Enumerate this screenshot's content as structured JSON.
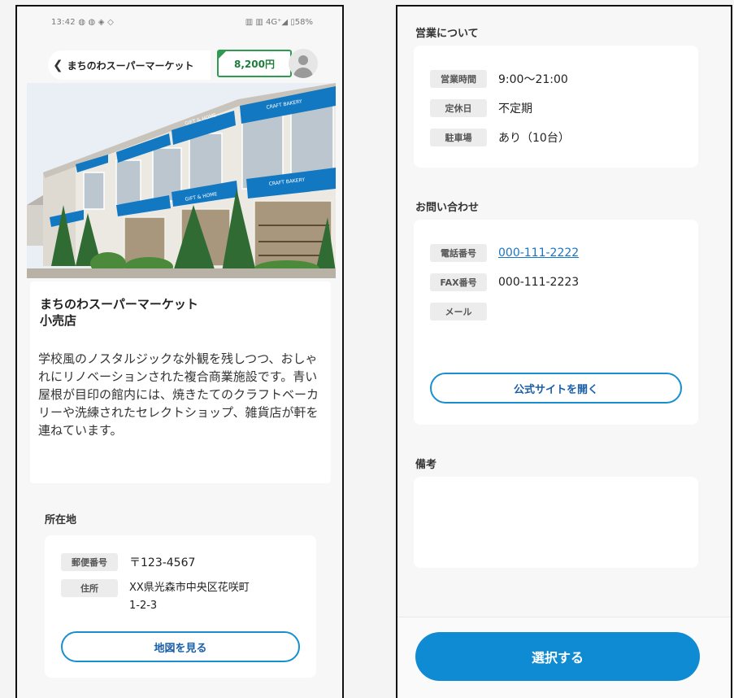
{
  "left": {
    "status": {
      "time": "13:42 ◍ ◍ ◈ ◇",
      "right": "▥ ▥ 4G⁺◢ ▯58%"
    },
    "header": {
      "back_label": "まちのわスーパーマーケット",
      "points": "8,200円"
    },
    "hero": {
      "awning_labels": [
        "CRAFT BAKERY",
        "CRAFT BAKERY",
        "GIFT & HOME",
        "GIFT & HOME"
      ]
    },
    "store": {
      "name_line1": "まちのわスーパーマーケット",
      "name_line2": "小売店",
      "description": "学校風のノスタルジックな外観を残しつつ、おしゃれにリノベーションされた複合商業施設です。青い屋根が目印の館内には、焼きたてのクラフトベーカリーや洗練されたセレクトショップ、雑貨店が軒を連ねています。"
    },
    "location": {
      "title": "所在地",
      "postal_label": "郵便番号",
      "postal_value": "〒123-4567",
      "address_label": "住所",
      "address_line1": "XX県光森市中央区花咲町",
      "address_line2": "1-2-3",
      "map_button": "地図を見る"
    }
  },
  "right": {
    "business": {
      "title": "営業について",
      "hours_label": "営業時間",
      "hours_value": "9:00〜21:00",
      "holiday_label": "定休日",
      "holiday_value": "不定期",
      "parking_label": "駐車場",
      "parking_value": "あり（10台）"
    },
    "contact": {
      "title": "お問い合わせ",
      "phone_label": "電話番号",
      "phone_value": "000-111-2222",
      "fax_label": "FAX番号",
      "fax_value": "000-111-2223",
      "mail_label": "メール",
      "site_button": "公式サイトを開く"
    },
    "notes": {
      "title": "備考"
    },
    "select_button": "選択する"
  },
  "colors": {
    "accent_blue": "#0f8bd3",
    "points_green": "#2e9a52",
    "link_blue": "#1a76c2",
    "awning_blue": "#1278c2"
  }
}
